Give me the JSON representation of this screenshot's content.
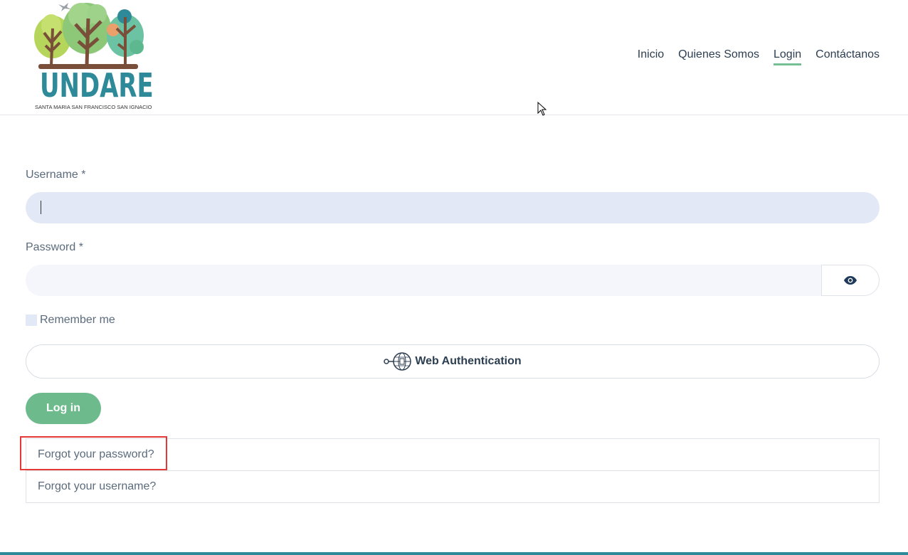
{
  "header": {
    "logo": {
      "name": "UNDARE",
      "subtitle": "SANTA MARIA  SAN FRANCISCO  SAN IGNACIO"
    },
    "nav": [
      {
        "label": "Inicio",
        "active": false
      },
      {
        "label": "Quienes Somos",
        "active": false
      },
      {
        "label": "Login",
        "active": true
      },
      {
        "label": "Contáctanos",
        "active": false
      }
    ]
  },
  "form": {
    "username_label": "Username",
    "username_required": " *",
    "username_value": "",
    "password_label": "Password",
    "password_required": " *",
    "password_value": "",
    "remember_label": "Remember me",
    "webauthn_label": "Web Authentication",
    "login_label": "Log in"
  },
  "links": {
    "forgot_password": "Forgot your password?",
    "forgot_username": "Forgot your username?"
  },
  "colors": {
    "accent_green": "#6dba8c",
    "brand_teal": "#2e8a99",
    "highlight_red": "#e53935"
  }
}
